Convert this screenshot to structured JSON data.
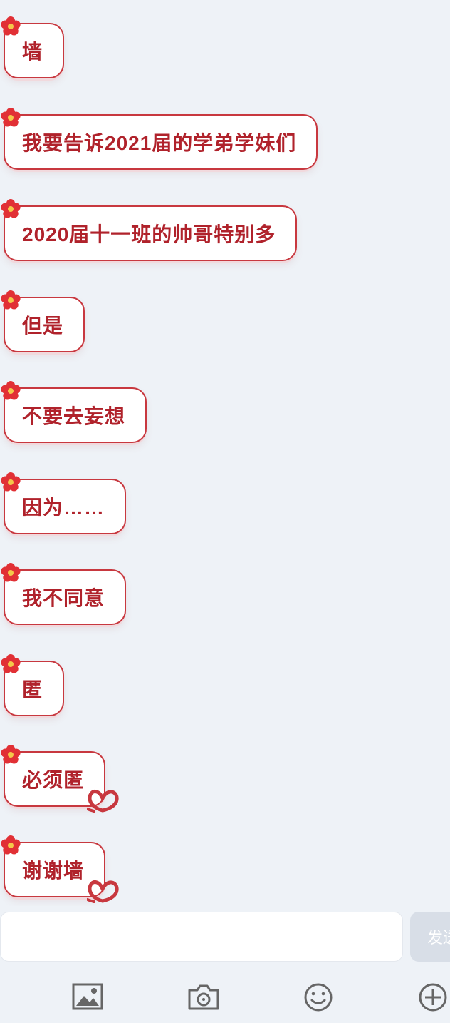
{
  "messages": [
    {
      "text": "墙",
      "heart": false
    },
    {
      "text": "我要告诉2021届的学弟学妹们",
      "heart": false
    },
    {
      "text": "2020届十一班的帅哥特别多",
      "heart": false
    },
    {
      "text": "但是",
      "heart": false
    },
    {
      "text": "不要去妄想",
      "heart": false
    },
    {
      "text": "因为……",
      "heart": false
    },
    {
      "text": "我不同意",
      "heart": false
    },
    {
      "text": "匿",
      "heart": false
    },
    {
      "text": "必须匿",
      "heart": true
    },
    {
      "text": "谢谢墙",
      "heart": true
    }
  ],
  "composer": {
    "input_value": "",
    "send_label": "发送"
  },
  "toolbar": {
    "icons": [
      "image-icon",
      "camera-icon",
      "emoji-icon",
      "plus-icon"
    ]
  },
  "colors": {
    "accent": "#c8383f",
    "text": "#b0222b",
    "background": "#eef2f7"
  }
}
